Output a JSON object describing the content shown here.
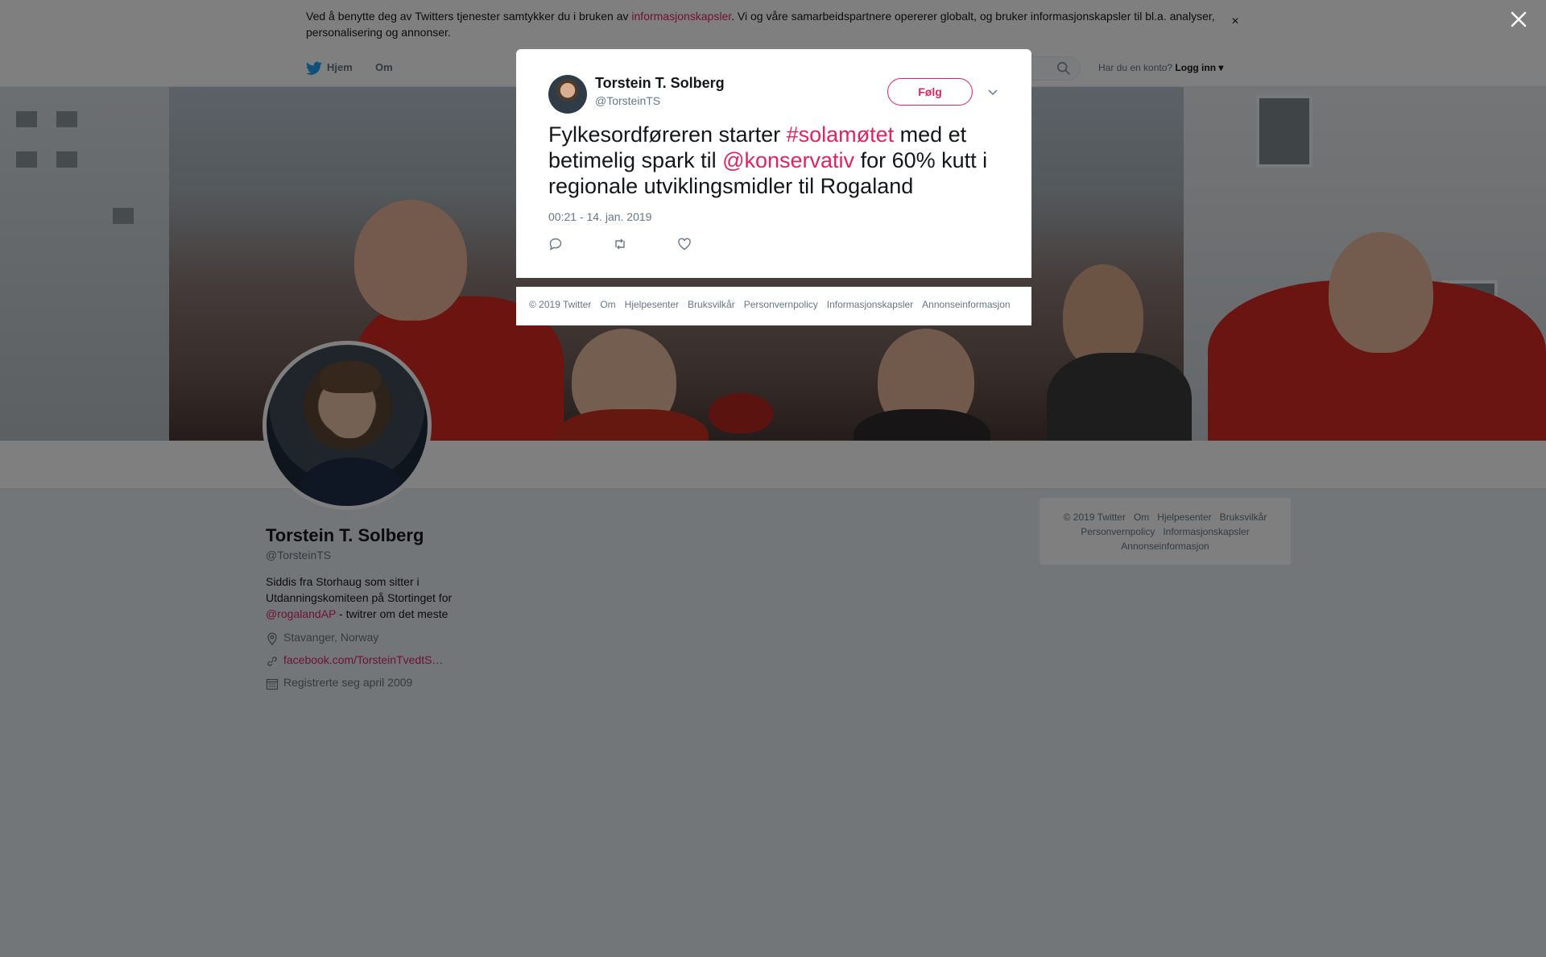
{
  "cookie": {
    "text_before": "Ved å benytte deg av Twitters tjenester samtykker du i bruken av ",
    "link": "informasjonskapsler",
    "text_after": ". Vi og våre samarbeidspartnere opererer globalt, og bruker informasjonskapsler til bl.a. analyser, personalisering og annonser.",
    "close": "×"
  },
  "nav": {
    "home": "Hjem",
    "about": "Om",
    "account_prompt": "Har du en konto?",
    "login": "Logg inn"
  },
  "profile": {
    "name": "Torstein T. Solberg",
    "handle": "@TorsteinTS",
    "bio_text": "Siddis fra Storhaug som sitter i Utdanningskomiteen på Stortinget for ",
    "bio_link": "@rogalandAP",
    "bio_tail": " - twitrer om det meste",
    "location": "Stavanger, Norway",
    "website": "facebook.com/TorsteinTvedtS…",
    "joined": "Registrerte seg april 2009"
  },
  "tweet": {
    "name": "Torstein T. Solberg",
    "handle": "@TorsteinTS",
    "follow_label": "Følg",
    "text_1": "Fylkesordføreren starter ",
    "hashtag": "#solamøtet",
    "text_2": " med et betimelig spark til ",
    "mention": "@konservativ",
    "text_3": " for 60% kutt i regionale utviklingsmidler til Rogaland",
    "timestamp": "00:21 - 14. jan. 2019"
  },
  "footer_links": [
    "© 2019 Twitter",
    "Om",
    "Hjelpesenter",
    "Bruksvilkår",
    "Personvernpolicy",
    "Informasjonskapsler",
    "Annonseinformasjon"
  ],
  "colors": {
    "accent": "#e0245e",
    "twitter_blue": "#1da1f2",
    "overlay": "rgba(0,0,0,0.5)"
  },
  "icons": [
    "twitter-bird-icon",
    "search-icon",
    "location-icon",
    "link-icon",
    "calendar-icon",
    "reply-icon",
    "retweet-icon",
    "like-icon",
    "chevron-down-icon",
    "close-icon"
  ]
}
